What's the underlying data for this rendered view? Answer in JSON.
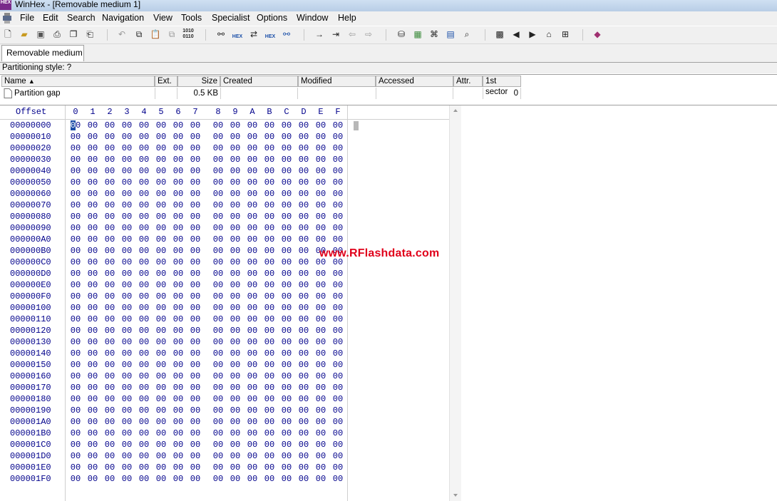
{
  "window": {
    "title": "WinHex - [Removable medium 1]",
    "app_icon_text": "HEX"
  },
  "menu": [
    "File",
    "Edit",
    "Search",
    "Navigation",
    "View",
    "Tools",
    "Specialist",
    "Options",
    "Window",
    "Help"
  ],
  "toolbar": {
    "icons": [
      "new-file-icon",
      "open-folder-icon",
      "save-icon",
      "print-icon",
      "properties-icon",
      "open-disk-icon",
      "undo-icon",
      "copy-icon",
      "paste-icon",
      "clipboard-icon",
      "write-binary-icon",
      "find-icon",
      "find-hex-icon",
      "replace-icon",
      "replace-hex-icon",
      "find-text-icon",
      "goto-offset-icon",
      "goto-sector-icon",
      "back-icon",
      "forward-icon",
      "edit-disk-icon",
      "ram-icon",
      "hash-icon",
      "calculator-icon",
      "search-icon",
      "scan-icon",
      "prev-icon",
      "next-icon",
      "snapshot-icon",
      "table-icon",
      "help-book-icon"
    ],
    "binary_label": "1010\n0110",
    "hex_label": "HEX"
  },
  "tab": {
    "label": "Removable medium 1"
  },
  "partitioning": {
    "text": "Partitioning style: ?"
  },
  "file_list": {
    "columns": [
      "Name",
      "Ext.",
      "Size",
      "Created",
      "Modified",
      "Accessed",
      "Attr.",
      "1st sector"
    ],
    "sort_indicator": "▲",
    "rows": [
      {
        "name": "Partition gap",
        "ext": "",
        "size": "0.5 KB",
        "created": "",
        "modified": "",
        "accessed": "",
        "attr": "",
        "first_sector": "0"
      }
    ]
  },
  "hex_view": {
    "offset_label": "Offset",
    "columns": [
      "0",
      "1",
      "2",
      "3",
      "4",
      "5",
      "6",
      "7",
      "8",
      "9",
      "A",
      "B",
      "C",
      "D",
      "E",
      "F"
    ],
    "offsets": [
      "00000000",
      "00000010",
      "00000020",
      "00000030",
      "00000040",
      "00000050",
      "00000060",
      "00000070",
      "00000080",
      "00000090",
      "000000A0",
      "000000B0",
      "000000C0",
      "000000D0",
      "000000E0",
      "000000F0",
      "00000100",
      "00000110",
      "00000120",
      "00000130",
      "00000140",
      "00000150",
      "00000160",
      "00000170",
      "00000180",
      "00000190",
      "000001A0",
      "000001B0",
      "000001C0",
      "000001D0",
      "000001E0",
      "000001F0"
    ],
    "byte_value": "00"
  },
  "watermark": {
    "text": "www.RFlashdata.com",
    "color": "#e0001b"
  },
  "colors": {
    "hex_text": "#00008b",
    "caret": "#1f4ea8"
  }
}
